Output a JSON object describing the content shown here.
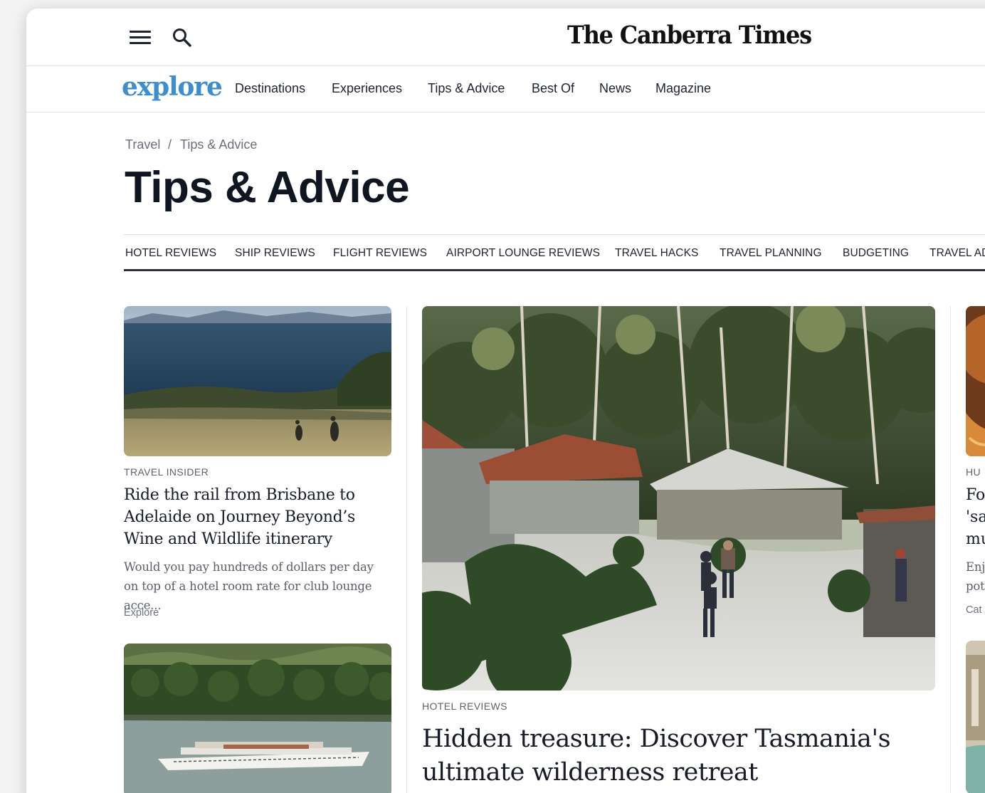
{
  "header": {
    "masthead": "The Canberra Times"
  },
  "subnav": {
    "logo": "explore",
    "links": [
      "Destinations",
      "Experiences",
      "Tips & Advice",
      "Best Of",
      "News",
      "Magazine"
    ]
  },
  "breadcrumb": [
    "Travel",
    "Tips & Advice"
  ],
  "breadcrumb_separator": "/",
  "page_title": "Tips & Advice",
  "categories": [
    "HOTEL REVIEWS",
    "SHIP REVIEWS",
    "FLIGHT REVIEWS",
    "AIRPORT LOUNGE REVIEWS",
    "TRAVEL HACKS",
    "TRAVEL PLANNING",
    "BUDGETING",
    "TRAVEL AD"
  ],
  "articles": {
    "left_top": {
      "tag": "TRAVEL INSIDER",
      "headline": "Ride the rail from Brisbane to Adelaide on Journey Beyond’s Wine and Wildlife itinerary",
      "excerpt": "Would you pay hundreds of dollars per day on top of a hotel room rate for club lounge acce...",
      "source": "Explore"
    },
    "featured": {
      "tag": "HOTEL REVIEWS",
      "headline": "Hidden treasure: Discover Tasmania's ultimate wilderness retreat"
    },
    "right_partial": {
      "tag": "HU",
      "headline_lines": [
        "Fo",
        "'sa",
        "mu"
      ],
      "excerpt_lines": [
        "Enj",
        "pot"
      ],
      "source": "Cat"
    }
  },
  "icons": {
    "menu": "hamburger-menu-icon",
    "search": "search-icon"
  },
  "colors": {
    "logo": "#3e8ecc",
    "text": "#1c2230",
    "muted": "#6a6f78"
  }
}
